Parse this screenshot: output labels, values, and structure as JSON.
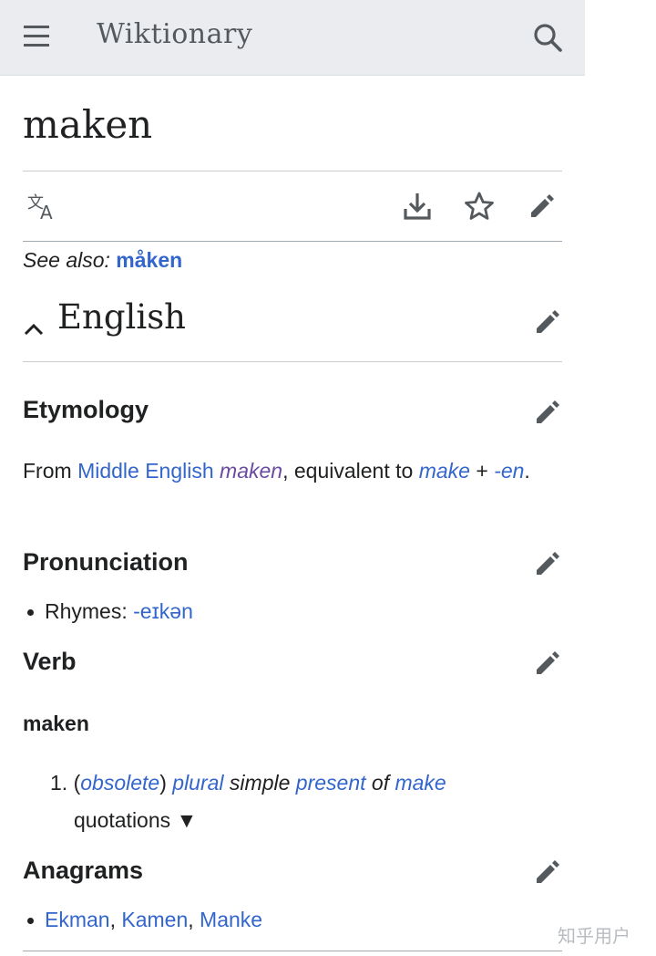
{
  "header": {
    "brand": "Wiktionary"
  },
  "page": {
    "title": "maken"
  },
  "see_also": {
    "prefix": "See also:",
    "link": "måken"
  },
  "language": {
    "name": "English"
  },
  "etymology": {
    "heading": "Etymology",
    "from": "From ",
    "lang_link": "Middle English",
    "term": "maken",
    "mid": ", equivalent to ",
    "part1": "make",
    "plus": " + ",
    "part2": "-en",
    "end": "."
  },
  "pronunciation": {
    "heading": "Pronunciation",
    "rhymes_label": "Rhymes: ",
    "rhymes_link": "-eɪkən"
  },
  "verb": {
    "heading": "Verb",
    "headword": "maken",
    "def_number": "1.",
    "open_paren": "(",
    "label": "obsolete",
    "close_paren": ")",
    "w_plural": "plural",
    "w_simple": " simple ",
    "w_present": "present",
    "w_of": " of ",
    "w_make": "make",
    "quotations": "quotations ▼"
  },
  "anagrams": {
    "heading": "Anagrams",
    "items": [
      "Ekman",
      "Kamen",
      "Manke"
    ],
    "sep": ", "
  },
  "watermark": "知乎用户",
  "colors": {
    "link": "#3366cc",
    "visited": "#6b4ba1",
    "text": "#202122",
    "icon": "#54595d",
    "header_bg": "#eaecf0"
  }
}
